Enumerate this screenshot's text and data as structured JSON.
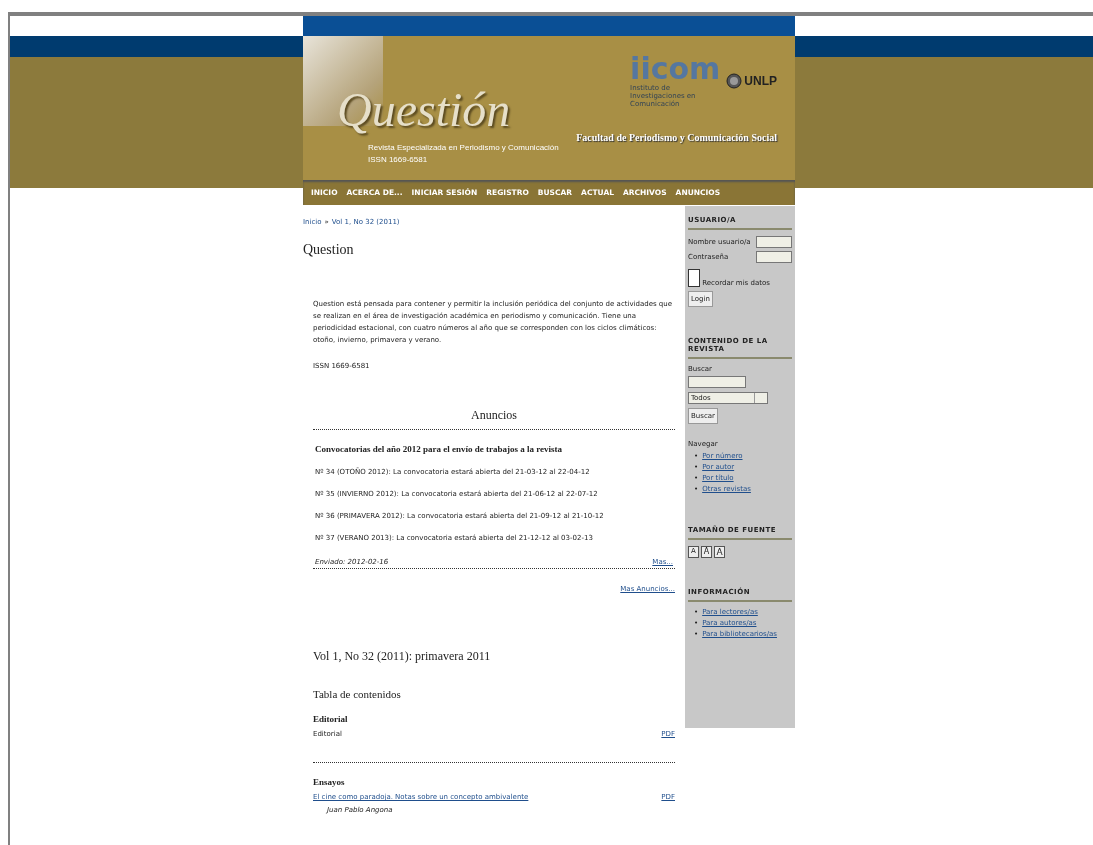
{
  "header": {
    "logo": "Questión",
    "subtitle": "Revista Especializada en Periodismo y Comunicación",
    "issn": "ISSN 1669-6581",
    "institute_logo": "iicom",
    "institute_name": "Instituto de Investigaciones en Comunicación",
    "university": "UNLP",
    "faculty": "Facultad de Periodismo y Comunicación Social"
  },
  "nav": [
    "INICIO",
    "ACERCA DE...",
    "INICIAR SESIÓN",
    "REGISTRO",
    "BUSCAR",
    "ACTUAL",
    "ARCHIVOS",
    "ANUNCIOS"
  ],
  "breadcrumb": [
    "Inicio",
    "Vol 1, No 32 (2011)"
  ],
  "breadcrumb_separator": "»",
  "title": "Question",
  "description": "Question está pensada para contener y permitir la inclusión periódica del conjunto de actividades que se realizan en el área de investigación académica en periodismo y comunicación. Tiene una periodicidad estacional, con cuatro números al año que se corresponden con los ciclos climáticos: otoño, invierno, primavera y verano.",
  "issn": "ISSN 1669-6581",
  "announcements": {
    "heading": "Anuncios",
    "title": "Convocatorias del año 2012 para el envío de trabajos a la revista",
    "items": [
      "Nº 34 (OTOÑO 2012): La convocatoria estará abierta del 21-03-12 al 22-04-12",
      "Nº 35 (INVIERNO 2012): La convocatoria estará abierta del 21-06-12 al 22-07-12",
      "Nº 36 (PRIMAVERA 2012): La convocatoria estará abierta del 21-09-12 al 21-10-12",
      "Nº 37 (VERANO 2013): La convocatoria estará abierta del 21-12-12 al 03-02-13"
    ],
    "sent": "Enviado: 2012-02-16",
    "more": "Mas...",
    "more_all": "Mas Anuncios..."
  },
  "issue": {
    "title": "Vol 1, No 32 (2011): primavera 2011",
    "toc": "Tabla de contenidos",
    "sections": [
      {
        "name": "Editorial",
        "articles": [
          {
            "title": "Editorial",
            "link": false,
            "file": "PDF"
          }
        ]
      },
      {
        "name": "Ensayos",
        "articles": [
          {
            "title": "El cine como paradoja. Notas sobre un concepto ambivalente",
            "link": true,
            "author": "Juan Pablo Angona",
            "file": "PDF"
          }
        ]
      }
    ]
  },
  "sidebar": {
    "bullet": "•",
    "user": {
      "heading": "USUARIO/A",
      "username_label": "Nombre usuario/a",
      "password_label": "Contraseña",
      "remember": "Recordar mis datos",
      "remember_checked": false,
      "login": "Login"
    },
    "content": {
      "heading": "CONTENIDO DE LA REVISTA",
      "search_label": "Buscar",
      "scope": "Todos",
      "search_button": "Buscar",
      "browse_label": "Navegar",
      "browse": [
        "Por número",
        "Por autor",
        "Por título",
        "Otras revistas"
      ]
    },
    "font": {
      "heading": "TAMAÑO DE FUENTE",
      "sizes": [
        "A",
        "A",
        "A"
      ]
    },
    "info": {
      "heading": "INFORMACIÓN",
      "links": [
        "Para lectores/as",
        "Para autores/as",
        "Para bibliotecarios/as"
      ]
    }
  }
}
